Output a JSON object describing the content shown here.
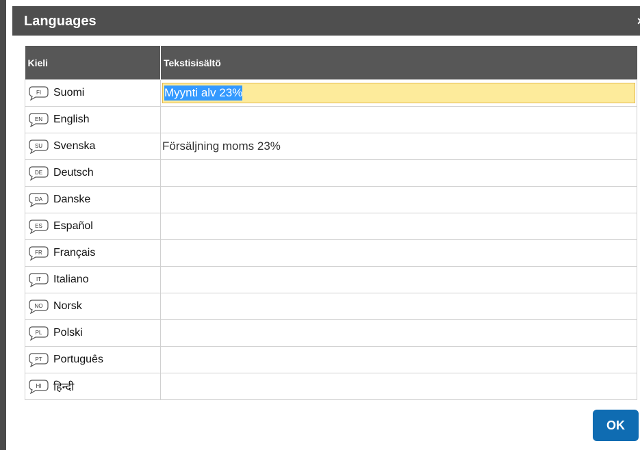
{
  "dialog": {
    "title": "Languages",
    "close_symbol": "×",
    "close_icon": "close-icon",
    "ok_label": "OK"
  },
  "table": {
    "headers": [
      "Kieli",
      "Tekstisisältö"
    ],
    "rows": [
      {
        "code": "FI",
        "language": "Suomi",
        "text": "Myynti alv 23%",
        "active": true
      },
      {
        "code": "EN",
        "language": "English",
        "text": ""
      },
      {
        "code": "SU",
        "language": "Svenska",
        "text": "Försäljning moms 23%"
      },
      {
        "code": "DE",
        "language": "Deutsch",
        "text": ""
      },
      {
        "code": "DA",
        "language": "Danske",
        "text": ""
      },
      {
        "code": "ES",
        "language": "Español",
        "text": ""
      },
      {
        "code": "FR",
        "language": "Français",
        "text": ""
      },
      {
        "code": "IT",
        "language": "Italiano",
        "text": ""
      },
      {
        "code": "NO",
        "language": "Norsk",
        "text": ""
      },
      {
        "code": "PL",
        "language": "Polski",
        "text": ""
      },
      {
        "code": "PT",
        "language": "Português",
        "text": ""
      },
      {
        "code": "HI",
        "language": "हिन्दी",
        "text": ""
      }
    ]
  },
  "colors": {
    "titlebar": "#4f4f4f",
    "header": "#575757",
    "active_input": "#fdeb9b",
    "selection": "#3399ff",
    "ok_button": "#0f6cb2"
  }
}
